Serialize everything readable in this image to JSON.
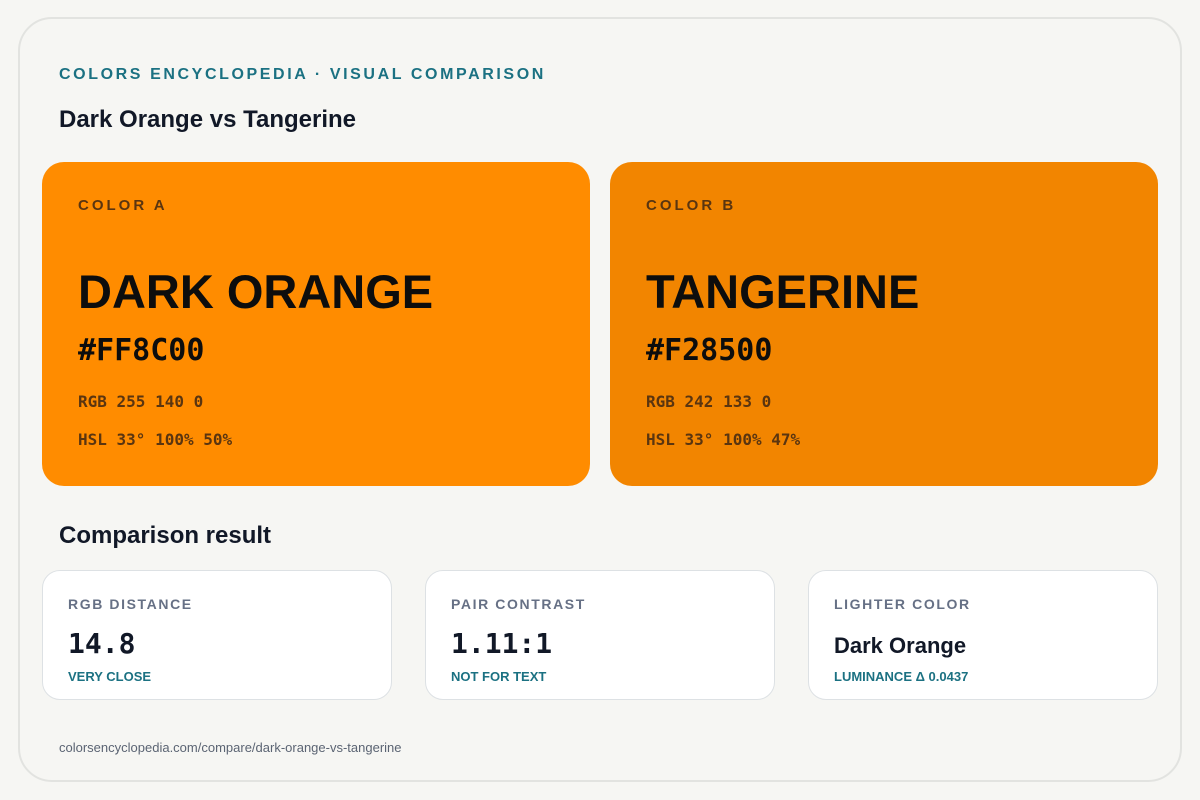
{
  "header": {
    "kicker": "COLORS ENCYCLOPEDIA · VISUAL COMPARISON",
    "title": "Dark Orange vs Tangerine"
  },
  "colors": [
    {
      "tag": "COLOR A",
      "name": "DARK ORANGE",
      "hex": "#FF8C00",
      "rgb": "RGB 255 140 0",
      "hsl": "HSL 33° 100% 50%",
      "swatch_color": "#FF8C00"
    },
    {
      "tag": "COLOR B",
      "name": "TANGERINE",
      "hex": "#F28500",
      "rgb": "RGB 242 133 0",
      "hsl": "HSL 33° 100% 47%",
      "swatch_color": "#F28500"
    }
  ],
  "comparison": {
    "title": "Comparison result",
    "metrics": [
      {
        "label": "RGB DISTANCE",
        "value": "14.8",
        "note": "VERY CLOSE"
      },
      {
        "label": "PAIR CONTRAST",
        "value": "1.11:1",
        "note": "NOT FOR TEXT"
      },
      {
        "label": "LIGHTER COLOR",
        "value": "Dark Orange",
        "note": "LUMINANCE Δ 0.0437"
      }
    ]
  },
  "footer": {
    "url": "colorsencyclopedia.com/compare/dark-orange-vs-tangerine"
  },
  "theme": {
    "accent": "#1B7182",
    "background": "#F6F6F3"
  }
}
